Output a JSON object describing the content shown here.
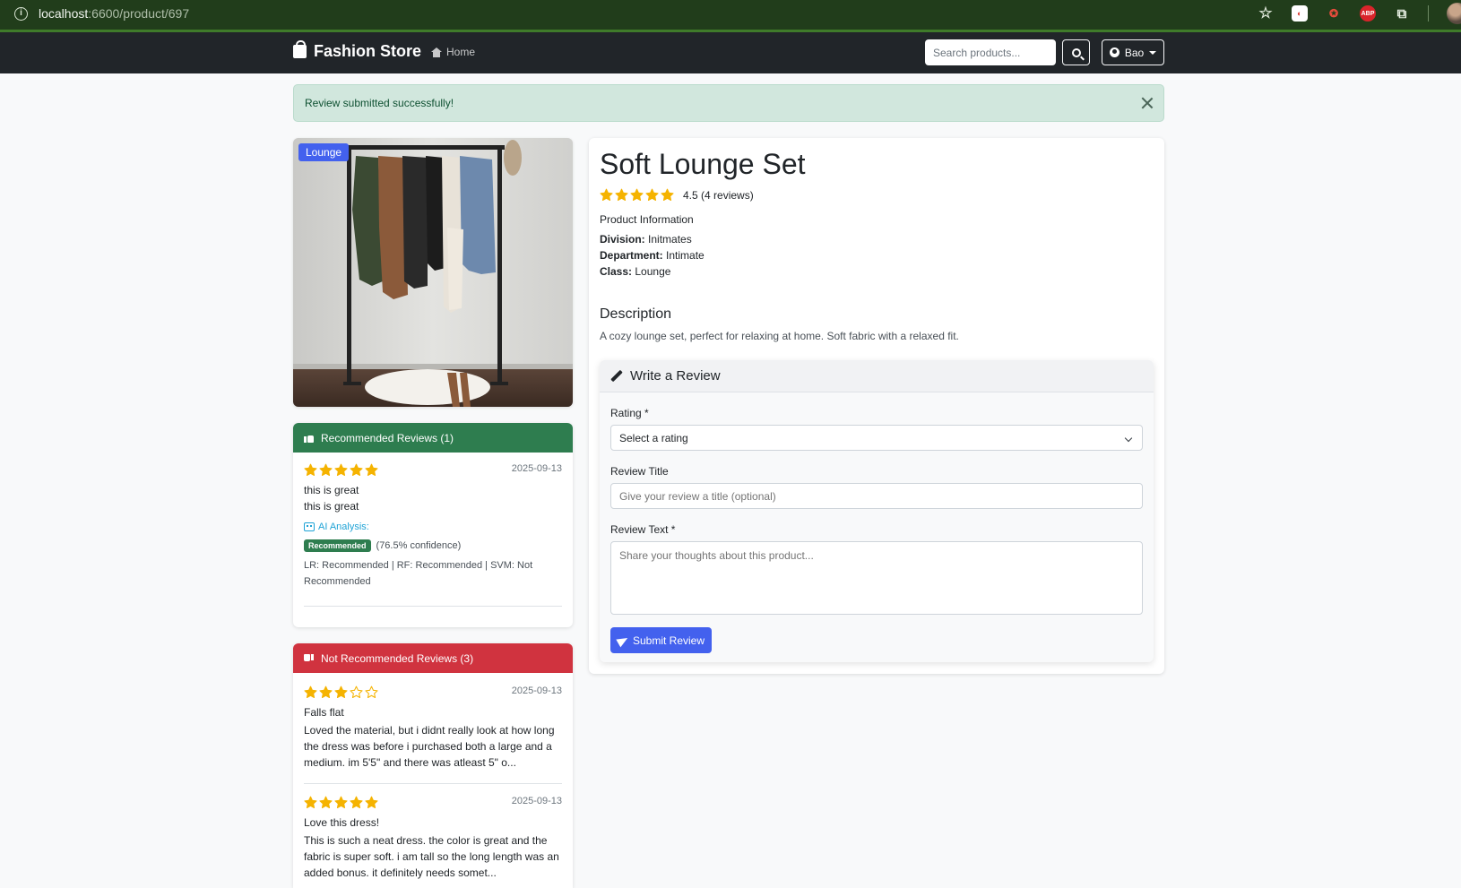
{
  "browser": {
    "url_host": "localhost",
    "url_path": ":6600/product/697",
    "icons": [
      "star-icon",
      "extension-a-icon",
      "extension-b-icon",
      "adblock-icon",
      "puzzle-icon",
      "profile-avatar"
    ]
  },
  "navbar": {
    "brand": "Fashion Store",
    "home_label": "Home",
    "search_placeholder": "Search products...",
    "user_label": "Bao"
  },
  "alert": {
    "message": "Review submitted successfully!"
  },
  "product": {
    "category_badge": "Lounge",
    "title": "Soft Lounge Set",
    "rating": 4.5,
    "rating_text": "4.5 (4 reviews)",
    "info_heading": "Product Information",
    "division_label": "Division:",
    "division_value": "Initmates",
    "department_label": "Department:",
    "department_value": "Intimate",
    "class_label": "Class:",
    "class_value": "Lounge",
    "description_heading": "Description",
    "description": "A cozy lounge set, perfect for relaxing at home. Soft fabric with a relaxed fit."
  },
  "recommended": {
    "header": "Recommended Reviews (1)",
    "reviews": [
      {
        "stars": 5,
        "date": "2025-09-13",
        "title": "this is great",
        "text": "this is great",
        "ai_label": "AI Analysis:",
        "prediction": "Recommended",
        "confidence": "(76.5% confidence)",
        "models": "LR: Recommended | RF: Recommended | SVM: Not Recommended"
      }
    ]
  },
  "not_recommended": {
    "header": "Not Recommended Reviews (3)",
    "reviews": [
      {
        "stars": 3,
        "date": "2025-09-13",
        "title": "Falls flat",
        "text": "Loved the material, but i didnt really look at how long the dress was before i purchased both a large and a medium. im 5'5\" and there was atleast 5\" o..."
      },
      {
        "stars": 5,
        "date": "2025-09-13",
        "title": "Love this dress!",
        "text": "This is such a neat dress. the color is great and the fabric is super soft. i am tall so the long length was an added bonus. it definitely needs somet..."
      }
    ]
  },
  "review_form": {
    "heading": "Write a Review",
    "rating_label": "Rating *",
    "rating_select_value": "Select a rating",
    "title_label": "Review Title",
    "title_placeholder": "Give your review a title (optional)",
    "text_label": "Review Text *",
    "text_placeholder": "Share your thoughts about this product...",
    "submit_label": "Submit Review"
  },
  "colors": {
    "navbar": "#212529",
    "accent": "#4361ee",
    "recommended_header": "#2e7d4f",
    "not_recommended_header": "#d0333f",
    "star": "#f5b301",
    "alert_bg": "#d1e7dd"
  }
}
